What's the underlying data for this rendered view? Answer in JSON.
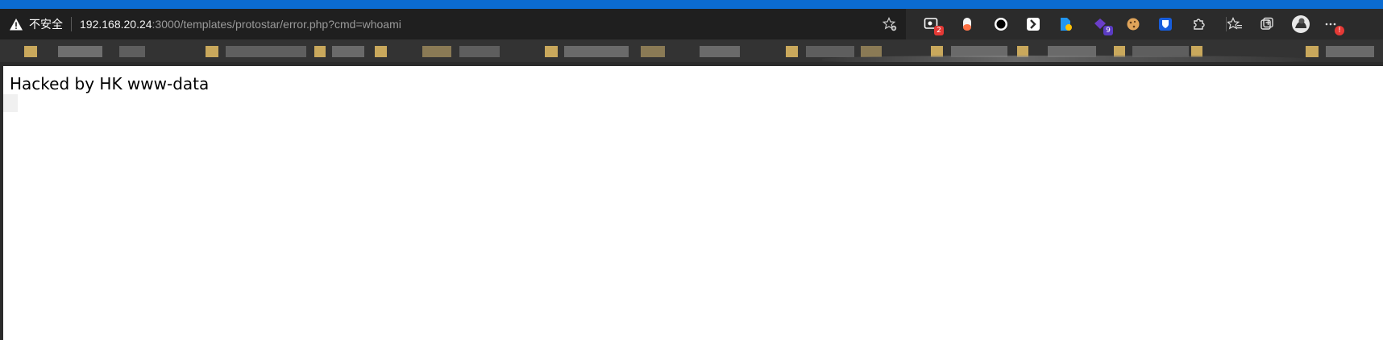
{
  "browser": {
    "security_label": "不安全",
    "url_host": "192.168.20.24",
    "url_rest": ":3000/templates/protostar/error.php?cmd=whoami",
    "extensions": [
      {
        "icon": "screen-capture-icon",
        "badge": "2",
        "badge_color": "#e53935"
      },
      {
        "icon": "capsule-icon",
        "badge": ""
      },
      {
        "icon": "record-circle-icon",
        "badge": ""
      },
      {
        "icon": "arrow-extension-icon",
        "badge": ""
      },
      {
        "icon": "document-ext-icon",
        "badge": ""
      },
      {
        "icon": "purple-ext-icon",
        "badge": "9",
        "badge_color": "#5b3cc4"
      },
      {
        "icon": "cookie-icon",
        "badge": ""
      },
      {
        "icon": "shield-ext-icon",
        "badge": ""
      },
      {
        "icon": "puzzle-icon",
        "badge": ""
      },
      {
        "icon": "favorites-icon",
        "badge": ""
      },
      {
        "icon": "collections-icon",
        "badge": ""
      },
      {
        "icon": "profile-avatar",
        "badge": ""
      },
      {
        "icon": "more-menu-icon",
        "badge": "!",
        "badge_color": "#e53935"
      }
    ]
  },
  "page": {
    "content_text": "Hacked by HK www-data"
  },
  "colors": {
    "titlebar": "#0b6bd0",
    "toolbar": "#2b2b2b",
    "address_bar": "#1f1f1f",
    "page_background": "#ffffff"
  }
}
